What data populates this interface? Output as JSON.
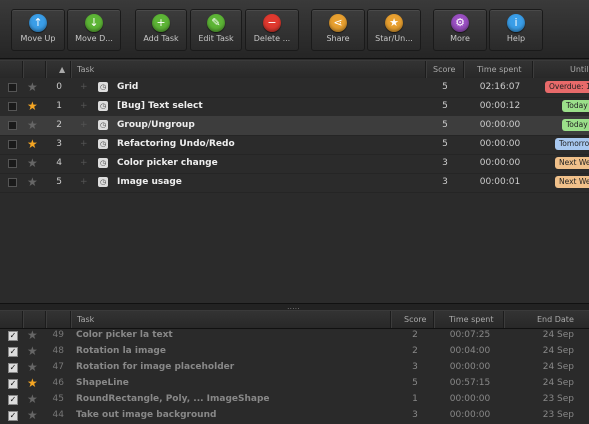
{
  "toolbar": {
    "buttons": [
      {
        "label": "Move Up",
        "icon": "arrow-up-icon",
        "color": "#3a9ee8"
      },
      {
        "label": "Move D...",
        "icon": "arrow-down-icon",
        "color": "#5db536"
      },
      {
        "label": "Add Task",
        "icon": "plus-icon",
        "color": "#5db536"
      },
      {
        "label": "Edit Task",
        "icon": "pencil-icon",
        "color": "#5db536"
      },
      {
        "label": "Delete ...",
        "icon": "minus-icon",
        "color": "#e0392f"
      },
      {
        "label": "Share",
        "icon": "share-icon",
        "color": "#e8a030"
      },
      {
        "label": "Star/Un...",
        "icon": "star-icon",
        "color": "#e8a030"
      },
      {
        "label": "More",
        "icon": "gear-icon",
        "color": "#9a4fc2"
      },
      {
        "label": "Help",
        "icon": "info-icon",
        "color": "#3a9ee8"
      }
    ]
  },
  "top_table": {
    "headers": {
      "task": "Task",
      "score": "Score",
      "time": "Time spent",
      "until": "Until"
    },
    "rows": [
      {
        "starred": false,
        "num": "0",
        "name": "Grid",
        "score": "5",
        "time": "02:16:07",
        "until": "Overdue: 1",
        "badge_color": "#e86a6a"
      },
      {
        "starred": true,
        "num": "1",
        "name": "[Bug] Text select",
        "score": "5",
        "time": "00:00:12",
        "until": "Today",
        "badge_color": "#9be08a"
      },
      {
        "starred": false,
        "num": "2",
        "name": "Group/Ungroup",
        "score": "5",
        "time": "00:00:00",
        "until": "Today",
        "badge_color": "#9be08a",
        "selected": true
      },
      {
        "starred": true,
        "num": "3",
        "name": "Refactoring Undo/Redo",
        "score": "5",
        "time": "00:00:00",
        "until": "Tomorro",
        "badge_color": "#a8c8f0"
      },
      {
        "starred": false,
        "num": "4",
        "name": "Color picker change",
        "score": "3",
        "time": "00:00:00",
        "until": "Next We",
        "badge_color": "#f0c08a"
      },
      {
        "starred": false,
        "num": "5",
        "name": "Image usage",
        "score": "3",
        "time": "00:00:01",
        "until": "Next Wee",
        "badge_color": "#f0c08a"
      }
    ]
  },
  "bottom_table": {
    "headers": {
      "task": "Task",
      "score": "Score",
      "time": "Time spent",
      "end": "End Date"
    },
    "rows": [
      {
        "starred": false,
        "num": "49",
        "name": "Color picker la text",
        "score": "2",
        "time": "00:07:25",
        "end": "24 Sep"
      },
      {
        "starred": false,
        "num": "48",
        "name": "Rotation la image",
        "score": "2",
        "time": "00:04:00",
        "end": "24 Sep"
      },
      {
        "starred": false,
        "num": "47",
        "name": "Rotation for image placeholder",
        "score": "3",
        "time": "00:00:00",
        "end": "24 Sep"
      },
      {
        "starred": true,
        "num": "46",
        "name": "ShapeLine",
        "score": "5",
        "time": "00:57:15",
        "end": "24 Sep"
      },
      {
        "starred": false,
        "num": "45",
        "name": "RoundRectangle, Poly, ... ImageShape",
        "score": "1",
        "time": "00:00:00",
        "end": "23 Sep"
      },
      {
        "starred": false,
        "num": "44",
        "name": "Take out image background",
        "score": "3",
        "time": "00:00:00",
        "end": "23 Sep"
      }
    ]
  }
}
